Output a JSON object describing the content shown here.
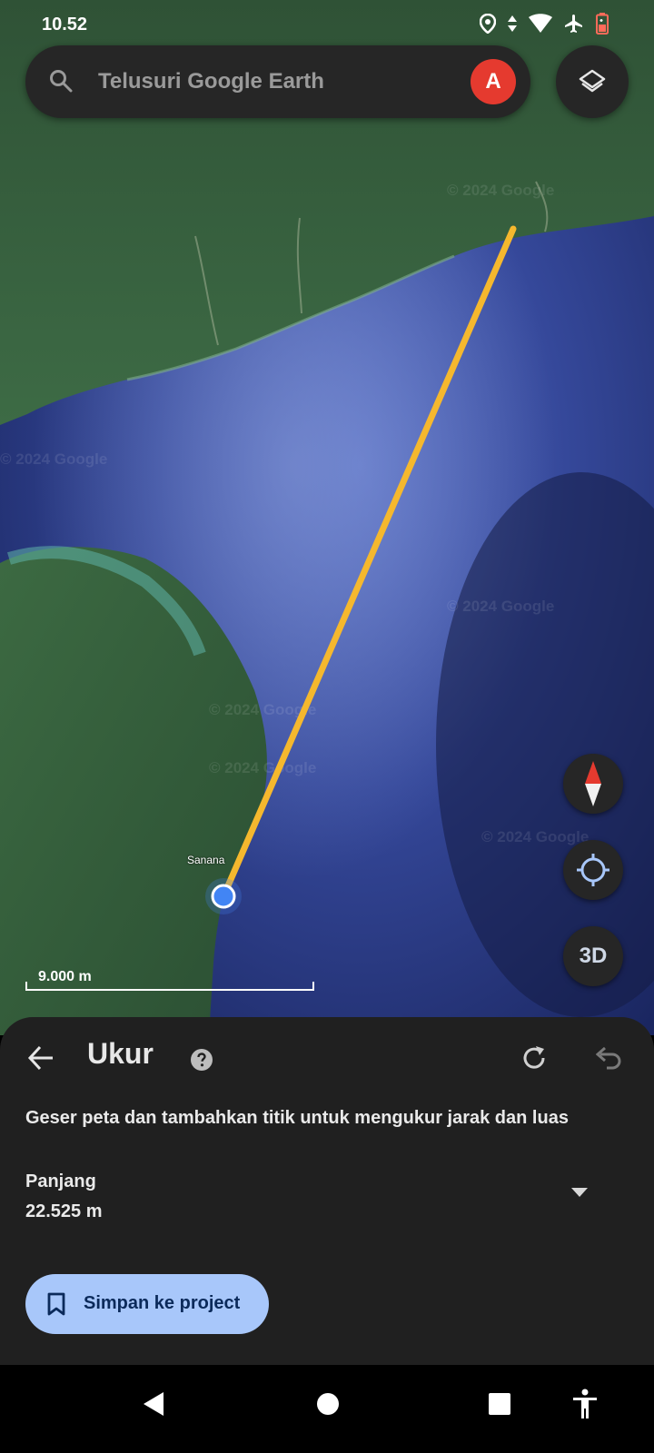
{
  "status_bar": {
    "time": "10.52",
    "icons": [
      "location-icon",
      "data-arrows-icon",
      "wifi-icon",
      "airplane-icon",
      "battery-icon"
    ]
  },
  "search": {
    "placeholder": "Telusuri Google Earth",
    "avatar_letter": "A"
  },
  "map": {
    "place_label": "Sanana",
    "scale_label": "9.000 m",
    "watermarks": [
      "© 2024 Google",
      "© 2024 Google",
      "© 2024 Google",
      "© 2024 Google",
      "© 2024 Google",
      "© 2024 Google"
    ],
    "three_d_label": "3D",
    "colors": {
      "measure_line": "#f5b82e",
      "point": "#4285f4",
      "land": "#2e5a3a",
      "sea": "#2a3f8a"
    }
  },
  "measure_panel": {
    "title": "Ukur",
    "instruction": "Geser peta dan tambahkan titik untuk mengukur jarak dan luas",
    "length_label": "Panjang",
    "length_value": "22.525 m",
    "save_button": "Simpan ke project"
  },
  "nav_bar": {
    "icons": [
      "back-icon",
      "home-icon",
      "recents-icon",
      "accessibility-icon"
    ]
  }
}
